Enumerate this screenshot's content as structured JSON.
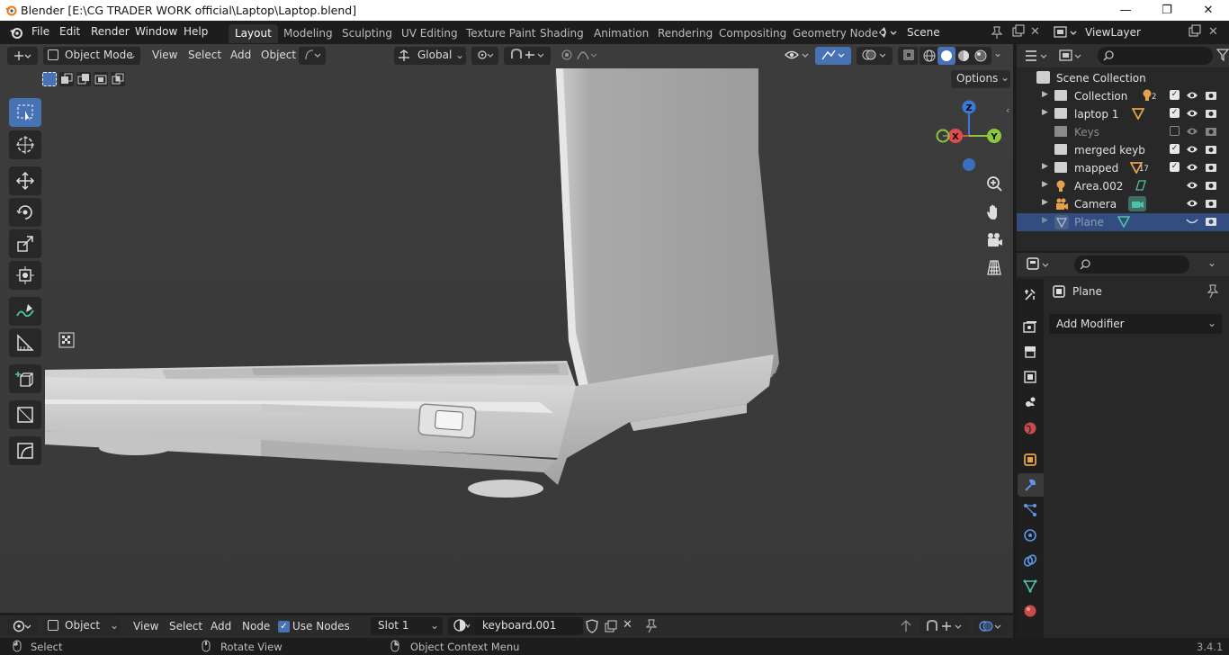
{
  "window": {
    "title": "Blender [E:\\CG TRADER WORK official\\Laptop\\Laptop.blend]",
    "minimize_glyph": "—",
    "maximize_glyph": "❐",
    "close_glyph": "✕"
  },
  "menu": {
    "items": [
      "File",
      "Edit",
      "Render",
      "Window",
      "Help"
    ]
  },
  "workspaces": {
    "tabs": [
      "Layout",
      "Modeling",
      "Sculpting",
      "UV Editing",
      "Texture Paint",
      "Shading",
      "Animation",
      "Rendering",
      "Compositing",
      "Geometry Node"
    ],
    "active": "Layout"
  },
  "scene": {
    "name": "Scene"
  },
  "view_layer": {
    "name": "ViewLayer"
  },
  "viewport_header": {
    "mode": "Object Mode",
    "menus": [
      "View",
      "Select",
      "Add",
      "Object"
    ],
    "orientation": "Global",
    "options_label": "Options"
  },
  "outliner": {
    "root": "Scene Collection",
    "rows": [
      {
        "name": "Collection",
        "badge": "2",
        "selected": false,
        "dim": false
      },
      {
        "name": "laptop 1",
        "badge": "",
        "selected": false,
        "dim": false
      },
      {
        "name": "Keys",
        "badge": "",
        "selected": false,
        "dim": true
      },
      {
        "name": "merged keyb",
        "badge": "",
        "selected": false,
        "dim": false
      },
      {
        "name": "mapped",
        "badge": "17",
        "selected": false,
        "dim": false
      },
      {
        "name": "Area.002",
        "badge": "",
        "selected": false,
        "dim": false
      },
      {
        "name": "Camera",
        "badge": "",
        "selected": false,
        "dim": false
      },
      {
        "name": "Plane",
        "badge": "",
        "selected": true,
        "dim": true
      }
    ]
  },
  "properties": {
    "object_name": "Plane",
    "add_modifier_label": "Add Modifier"
  },
  "shader_header": {
    "editor_mode": "Object",
    "menus": [
      "View",
      "Select",
      "Add",
      "Node"
    ],
    "use_nodes_label": "Use Nodes",
    "use_nodes_checked": true,
    "slot": "Slot 1",
    "material": "keyboard.001"
  },
  "status": {
    "select": "Select",
    "rotate": "Rotate View",
    "context": "Object Context Menu",
    "version": "3.4.1"
  },
  "gizmo": {
    "x": "X",
    "y": "Y",
    "z": "Z"
  },
  "colors": {
    "accent": "#4772b3",
    "selection": "#334d80",
    "x_axis": "#e34c4c",
    "y_axis": "#8bc83c",
    "z_axis": "#3b79d8"
  }
}
